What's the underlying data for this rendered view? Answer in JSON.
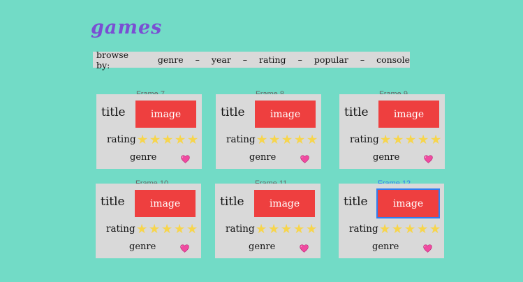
{
  "page": {
    "title": "games"
  },
  "browse": {
    "label": "browse by:",
    "options": [
      "genre",
      "year",
      "rating",
      "popular",
      "console"
    ],
    "separator": "–"
  },
  "cards": [
    {
      "frame_label": "Frame 7",
      "title": "title",
      "image_label": "image",
      "rating_label": "rating",
      "stars": 5,
      "genre_label": "genre",
      "selected": false
    },
    {
      "frame_label": "Frame 8",
      "title": "title",
      "image_label": "image",
      "rating_label": "rating",
      "stars": 5,
      "genre_label": "genre",
      "selected": false
    },
    {
      "frame_label": "Frame 9",
      "title": "title",
      "image_label": "image",
      "rating_label": "rating",
      "stars": 5,
      "genre_label": "genre",
      "selected": false
    },
    {
      "frame_label": "Frame 10",
      "title": "title",
      "image_label": "image",
      "rating_label": "rating",
      "stars": 5,
      "genre_label": "genre",
      "selected": false
    },
    {
      "frame_label": "Frame 11",
      "title": "title",
      "image_label": "image",
      "rating_label": "rating",
      "stars": 5,
      "genre_label": "genre",
      "selected": false
    },
    {
      "frame_label": "Frame 12",
      "title": "title",
      "image_label": "image",
      "rating_label": "rating",
      "stars": 5,
      "genre_label": "genre",
      "selected": true
    }
  ],
  "colors": {
    "background": "#72dbc6",
    "card": "#d9d9d9",
    "image_block": "#ee3f3f",
    "title_purple": "#7a4fd3",
    "selection_blue": "#2f7df0",
    "heart_pink": "#f04aa0",
    "star_yellow": "#f7d54c"
  },
  "icons": {
    "star": "star-icon",
    "heart": "heart-icon"
  }
}
